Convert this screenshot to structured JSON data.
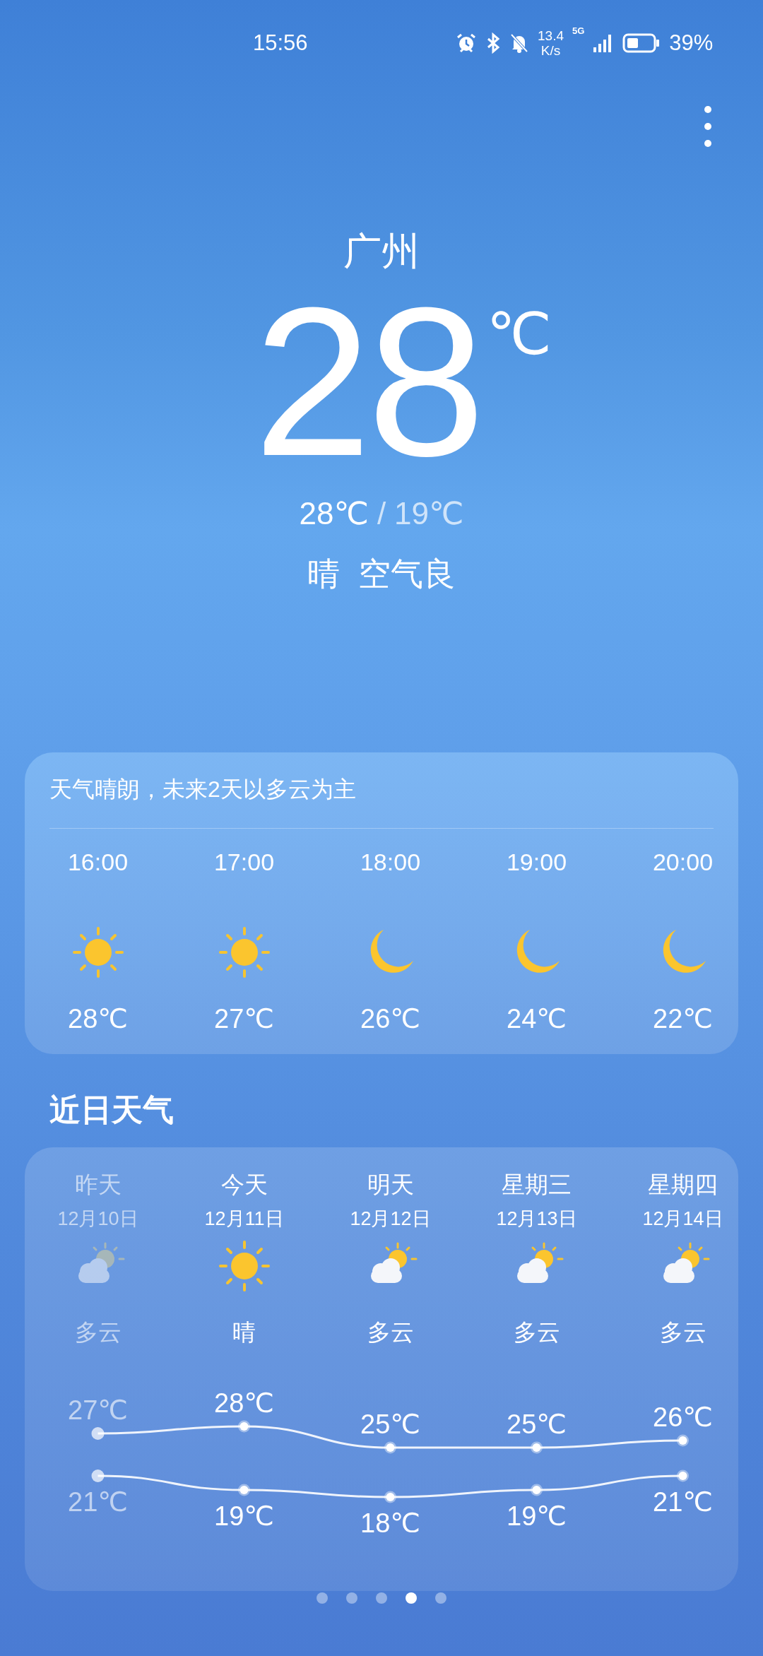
{
  "status_bar": {
    "time": "15:56",
    "net_speed": "13.4",
    "net_unit": "K/s",
    "network": "5G",
    "battery": "39%"
  },
  "city": "广州",
  "temperature": "28",
  "unit": "℃",
  "high_low": {
    "high": "28℃",
    "separator": "/",
    "low": "19℃"
  },
  "condition": "晴",
  "air_quality": "空气良",
  "hourly": {
    "summary": "天气晴朗，未来2天以多云为主",
    "hours": [
      {
        "time": "16:00",
        "kind": "sun",
        "temp": "28℃"
      },
      {
        "time": "17:00",
        "kind": "sun",
        "temp": "27℃"
      },
      {
        "time": "18:00",
        "kind": "moon",
        "temp": "26℃"
      },
      {
        "time": "19:00",
        "kind": "moon",
        "temp": "24℃"
      },
      {
        "time": "20:00",
        "kind": "moon",
        "temp": "22℃"
      }
    ]
  },
  "daily": {
    "title": "近日天气",
    "days": [
      {
        "name": "昨天",
        "date": "12月10日",
        "kind": "partly-cloudy",
        "condition": "多云",
        "high": "27℃",
        "low": "21℃",
        "past": true
      },
      {
        "name": "今天",
        "date": "12月11日",
        "kind": "sun",
        "condition": "晴",
        "high": "28℃",
        "low": "19℃",
        "past": false
      },
      {
        "name": "明天",
        "date": "12月12日",
        "kind": "partly-cloudy",
        "condition": "多云",
        "high": "25℃",
        "low": "18℃",
        "past": false
      },
      {
        "name": "星期三",
        "date": "12月13日",
        "kind": "partly-cloudy",
        "condition": "多云",
        "high": "25℃",
        "low": "19℃",
        "past": false
      },
      {
        "name": "星期四",
        "date": "12月14日",
        "kind": "partly-cloudy",
        "condition": "多云",
        "high": "26℃",
        "low": "21℃",
        "past": false
      }
    ]
  },
  "pages": [
    {
      "selected": false
    },
    {
      "selected": false
    },
    {
      "selected": false
    },
    {
      "selected": true
    },
    {
      "selected": false
    }
  ]
}
